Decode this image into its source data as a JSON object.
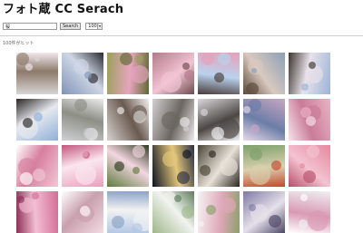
{
  "header": {
    "title": "フォト蔵 CC Serach"
  },
  "search": {
    "query": "桜",
    "button_label": "Search",
    "count_value": "100",
    "count_arrow": "▾"
  },
  "results": {
    "hit_count_text": "100件がヒット"
  },
  "thumbnails": [
    {
      "c1": "#d8d4d6",
      "c2": "#8d7a6a",
      "c3": "#f3e8ee"
    },
    {
      "c1": "#7f93b8",
      "c2": "#cfd7e6",
      "c3": "#2a2a30"
    },
    {
      "c1": "#9aa05a",
      "c2": "#e7a5bf",
      "c3": "#5d6a2f"
    },
    {
      "c1": "#b47a8a",
      "c2": "#f2c4d4",
      "c3": "#6b4a4f"
    },
    {
      "c1": "#e89fb8",
      "c2": "#b9d2ee",
      "c3": "#4a3a38"
    },
    {
      "c1": "#8aa0b6",
      "c2": "#d9c9c0",
      "c3": "#5b4a3a"
    },
    {
      "c1": "#9ab3d9",
      "c2": "#e8e2ea",
      "c3": "#3d3530"
    },
    {
      "c1": "#8fb0da",
      "c2": "#e6e8ee",
      "c3": "#2a2624"
    },
    {
      "c1": "#cfd0d4",
      "c2": "#8d8f86",
      "c3": "#eaeaea"
    },
    {
      "c1": "#d7d2d0",
      "c2": "#6a5a50",
      "c3": "#f1eeee"
    },
    {
      "c1": "#d4d0d2",
      "c2": "#6b6660",
      "c3": "#eee9ec"
    },
    {
      "c1": "#dad8dc",
      "c2": "#4c4744",
      "c3": "#f4f2f4"
    },
    {
      "c1": "#c8a6c4",
      "c2": "#6b7da6",
      "c3": "#e9d9ea"
    },
    {
      "c1": "#e9b4c6",
      "c2": "#c97b97",
      "c3": "#f7e2ea"
    },
    {
      "c1": "#f0c8d6",
      "c2": "#d77f9e",
      "c3": "#ffffff"
    },
    {
      "c1": "#e89fbc",
      "c2": "#fbe6ee",
      "c3": "#c2557d"
    },
    {
      "c1": "#5e7a3b",
      "c2": "#f3d6e1",
      "c3": "#2e3a1f"
    },
    {
      "c1": "#0e1322",
      "c2": "#e3c77a",
      "c3": "#2a2f45"
    },
    {
      "c1": "#4a4438",
      "c2": "#e8e2d8",
      "c3": "#2a2520"
    },
    {
      "c1": "#7da06a",
      "c2": "#d9cfae",
      "c3": "#c6482d"
    },
    {
      "c1": "#e5889f",
      "c2": "#f3c3d1",
      "c3": "#b8506a"
    },
    {
      "c1": "#d46d96",
      "c2": "#f2bfd2",
      "c3": "#8a2f55"
    },
    {
      "c1": "#f3dbe4",
      "c2": "#c9a0ae",
      "c3": "#ffffff"
    },
    {
      "c1": "#b4c8e4",
      "c2": "#f2f2f2",
      "c3": "#8aa3c8"
    },
    {
      "c1": "#9fb88a",
      "c2": "#f1f3f0",
      "c3": "#5f7d5a"
    },
    {
      "c1": "#f4f4f4",
      "c2": "#e0a8b8",
      "c3": "#8aa06a"
    },
    {
      "c1": "#7f7aa4",
      "c2": "#e5e0ea",
      "c3": "#4d4766"
    },
    {
      "c1": "#efeff2",
      "c2": "#d99ab3",
      "c3": "#ffffff"
    }
  ]
}
